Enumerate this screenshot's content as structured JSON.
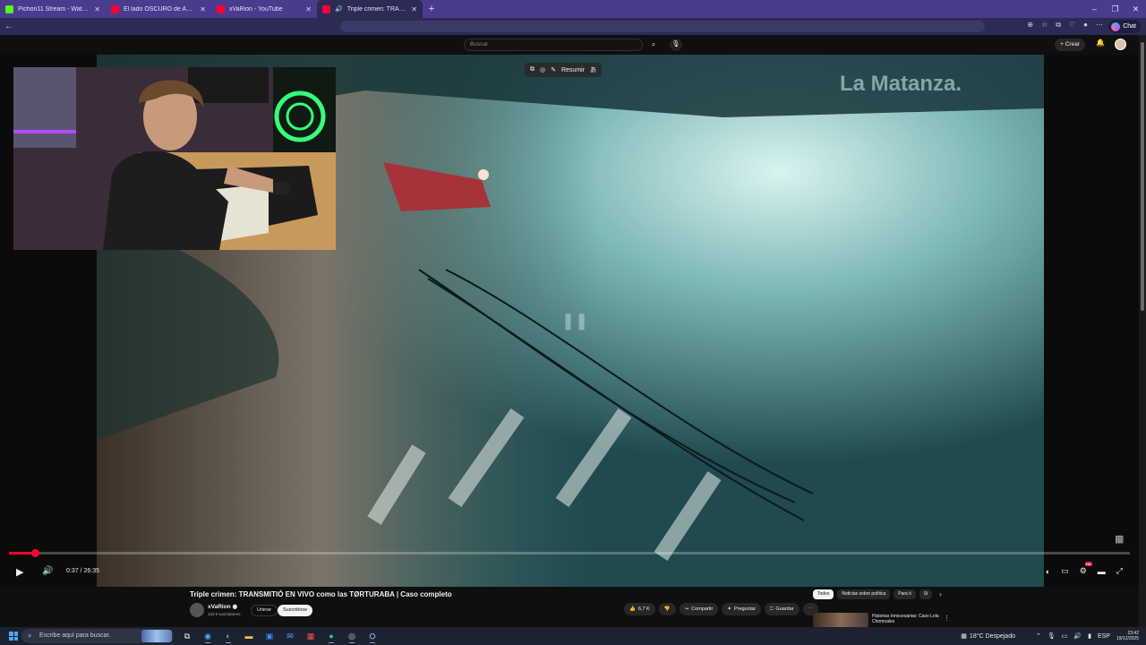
{
  "browser": {
    "tabs": [
      {
        "title": "Pichon11 Stream - Watch Live on",
        "favicon_color": "#53fc18",
        "active": false
      },
      {
        "title": "El lado OSCURO de ARGENTINA | E",
        "favicon_color": "#ff0033",
        "active": false
      },
      {
        "title": "xVaRion - YouTube",
        "favicon_color": "#ff0033",
        "active": false
      },
      {
        "title": "Triple crimen: TRANSMITIÓ EN",
        "favicon_color": "#ff0033",
        "active": true
      }
    ],
    "new_tab": "+",
    "window_controls": [
      "–",
      "❐",
      "✕"
    ],
    "chat_label": "Chat"
  },
  "youtube": {
    "search_placeholder": "Buscar",
    "create_label": "Crear",
    "video_overlay": {
      "summary_label": "Resumir"
    },
    "player": {
      "time": "0:37 / 26:35",
      "progress_fraction": 0.0232,
      "hd_badge": "HD"
    },
    "title": "Triple crimen: TRANSMITIÓ EN VIVO como las TØRTURABA | Caso completo",
    "channel": {
      "name": "xVaRion",
      "subs": "133 k suscriptores"
    },
    "join_label": "Unirse",
    "subscribe_label": "Suscribirse",
    "likes": "6,7 K",
    "share_label": "Compartir",
    "ask_label": "Preguntar",
    "save_label": "Guardar",
    "chips": [
      "Todos",
      "Noticias sobre política",
      "Para ti",
      "Si"
    ],
    "recommendation": {
      "title": "Historias Innecesarias: Caso Lola Chomnales"
    },
    "video_caption": "La Matanza."
  },
  "taskbar": {
    "search_placeholder": "Escribe aquí para buscar.",
    "weather": "18°C  Despejado",
    "lang": "ESP",
    "time": "23:42",
    "date": "19/12/2025",
    "accent_color": "#4fa8ff"
  }
}
